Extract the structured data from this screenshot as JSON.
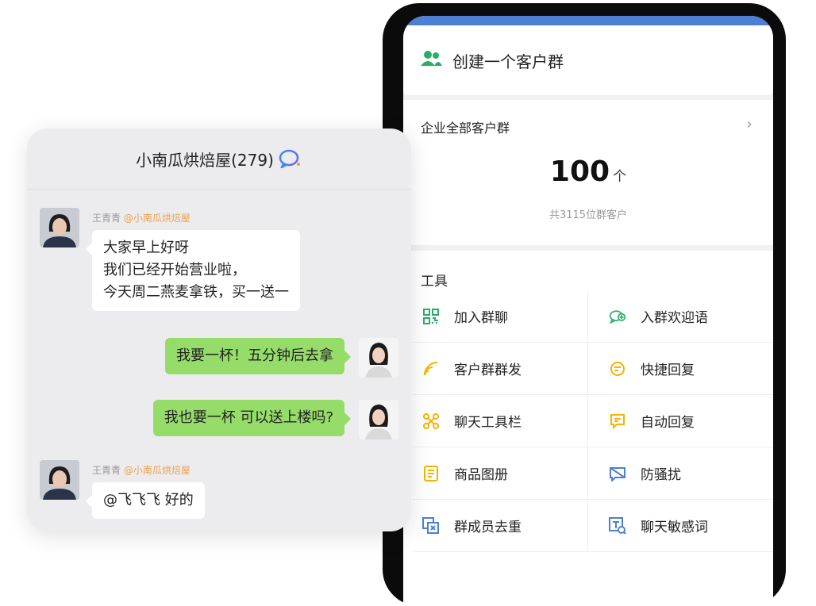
{
  "phone": {
    "create_group": {
      "label": "创建一个客户群",
      "icon": "group-add-icon",
      "icon_color": "#2aae67"
    },
    "all_groups": {
      "title": "企业全部客户群",
      "count": "100",
      "unit": "个",
      "subtitle": "共3115位群客户"
    },
    "tools": {
      "title": "工具",
      "items": [
        {
          "label": "加入群聊",
          "icon": "qrcode-icon",
          "color": "#2aae67"
        },
        {
          "label": "入群欢迎语",
          "icon": "welcome-chat-icon",
          "color": "#2aae67"
        },
        {
          "label": "客户群群发",
          "icon": "broadcast-icon",
          "color": "#f4b400"
        },
        {
          "label": "快捷回复",
          "icon": "quick-reply-icon",
          "color": "#f4b400"
        },
        {
          "label": "聊天工具栏",
          "icon": "toolbar-icon",
          "color": "#f4b400"
        },
        {
          "label": "自动回复",
          "icon": "auto-reply-icon",
          "color": "#f4b400"
        },
        {
          "label": "商品图册",
          "icon": "catalog-icon",
          "color": "#f4b400"
        },
        {
          "label": "防骚扰",
          "icon": "anti-harass-icon",
          "color": "#4d7fd4"
        },
        {
          "label": "群成员去重",
          "icon": "dedupe-icon",
          "color": "#4d7fd4"
        },
        {
          "label": "聊天敏感词",
          "icon": "sensitive-word-icon",
          "color": "#4d7fd4"
        }
      ]
    }
  },
  "chat": {
    "title": "小南瓜烘焙屋(279)",
    "messages": [
      {
        "sender": "王青青",
        "mention": "@小南瓜烘焙屋",
        "side": "left",
        "lines": [
          "大家早上好呀",
          "我们已经开始营业啦，",
          "今天周二燕麦拿铁，买一送一"
        ]
      },
      {
        "side": "right",
        "lines": [
          "我要一杯！五分钟后去拿"
        ]
      },
      {
        "side": "right",
        "lines": [
          "我也要一杯 可以送上楼吗?"
        ]
      },
      {
        "sender": "王青青",
        "mention": "@小南瓜烘焙屋",
        "side": "left",
        "lines": [
          "@飞飞飞 好的"
        ]
      }
    ]
  }
}
